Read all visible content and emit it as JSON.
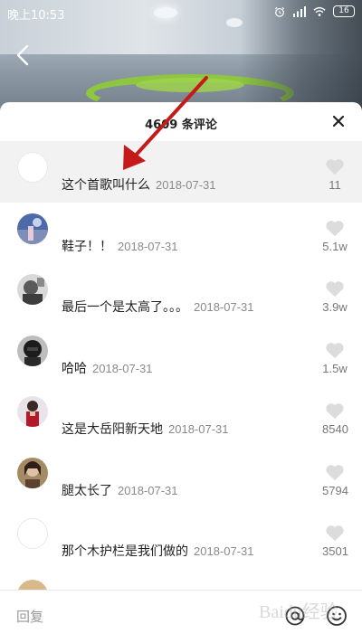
{
  "status_bar": {
    "time": "晚上10:53",
    "battery": "16",
    "icons": [
      "alarm-icon",
      "signal-icon",
      "wifi-icon",
      "battery-icon"
    ]
  },
  "sheet": {
    "title": "4609 条评论"
  },
  "comments": [
    {
      "text": "这个首歌叫什么",
      "date": "2018-07-31",
      "likes": "11"
    },
    {
      "text": "鞋子！！",
      "date": "2018-07-31",
      "likes": "5.1w"
    },
    {
      "text": "最后一个是太高了。。。",
      "date": "2018-07-31",
      "likes": "3.9w"
    },
    {
      "text": "哈哈",
      "date": "2018-07-31",
      "likes": "1.5w"
    },
    {
      "text": "这是大岳阳新天地",
      "date": "2018-07-31",
      "likes": "8540"
    },
    {
      "text": "腿太长了",
      "date": "2018-07-31",
      "likes": "5794"
    },
    {
      "text": "那个木护栏是我们做的",
      "date": "2018-07-31",
      "likes": "3501"
    }
  ],
  "reply_bar": {
    "placeholder": "回复"
  },
  "watermark": "Baidu经验",
  "colors": {
    "annotation_arrow": "#c41a1a",
    "like_heart": "#dcdcdc",
    "highlight_row": "#f2f2f2"
  }
}
